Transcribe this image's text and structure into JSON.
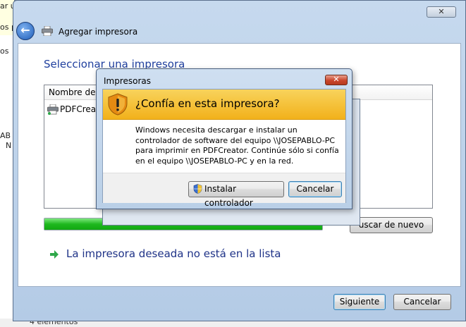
{
  "background": {
    "top_left_texts": [
      "ar u",
      "os p",
      "os"
    ],
    "side_texts": [
      "AB",
      "N"
    ],
    "status_text": "4 elementos"
  },
  "wizard": {
    "close_label": "✕",
    "nav": {
      "back_glyph": "←",
      "title": "Agregar impresora"
    },
    "heading": "Seleccionar una impresora",
    "list": {
      "column_header": "Nombre de la",
      "items": [
        "PDFCreato"
      ]
    },
    "progress_fraction": 1.0,
    "search_again_label": "uscar de nuevo",
    "missing_printer_link": "La impresora deseada no está en la lista",
    "next_label": "Siguiente",
    "cancel_label": "Cancelar"
  },
  "dialog": {
    "title": "Impresoras",
    "close_label": "✕",
    "banner": "¿Confía en esta impresora?",
    "message": "Windows necesita descargar e instalar un controlador de software del equipo \\\\JOSEPABLO-PC para imprimir en PDFCreator.  Continúe sólo si confía en el equipo \\\\JOSEPABLO-PC y en la red.",
    "install_label": "Instalar controlador",
    "cancel_label": "Cancelar"
  },
  "colors": {
    "heading": "#1f3f9e",
    "banner": "#f2b11b",
    "progress": "#1fb81f",
    "link": "#1e3287"
  }
}
